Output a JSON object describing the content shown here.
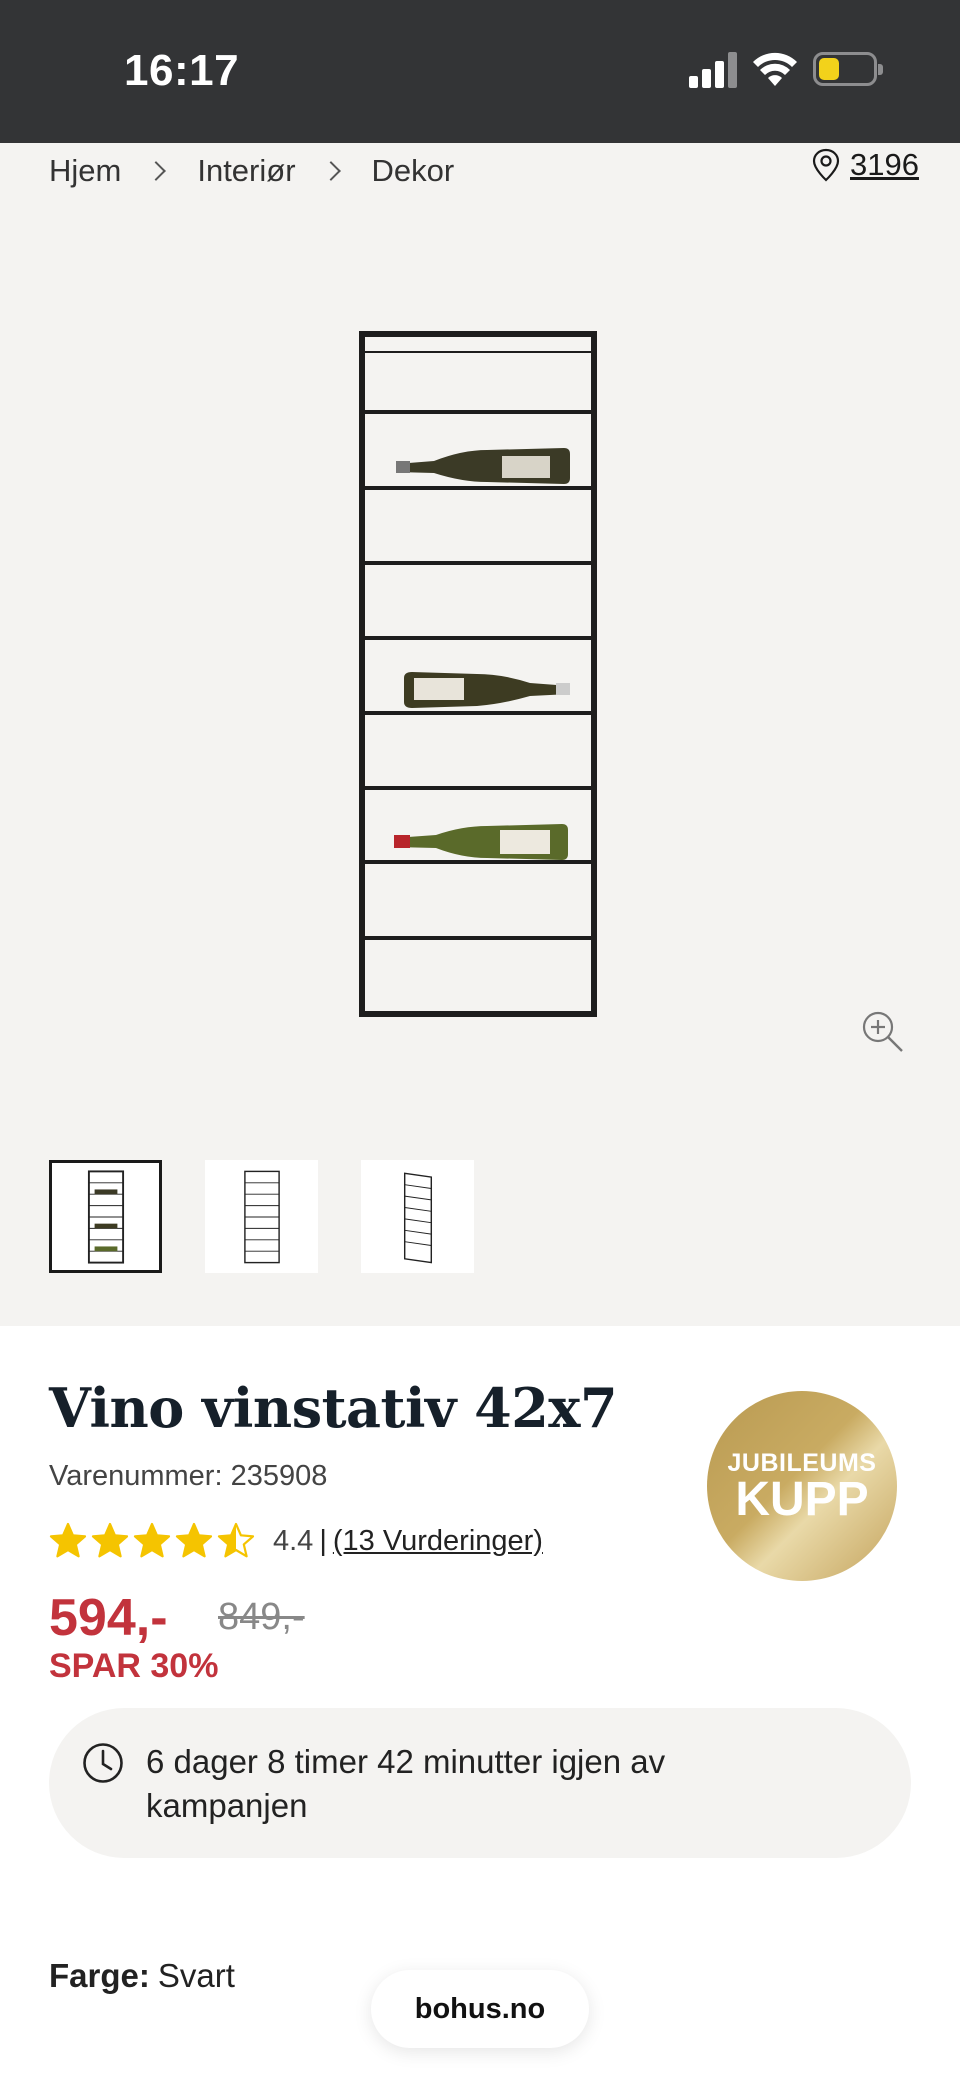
{
  "status_bar": {
    "time": "16:17",
    "battery_color": "#f2d21b"
  },
  "breadcrumb": {
    "items": [
      "Hjem",
      "Interiør",
      "Dekor"
    ]
  },
  "store": {
    "icon": "location-pin-icon",
    "number": "3196"
  },
  "gallery": {
    "background": "#f4f3f1",
    "zoom_icon": "zoom-in-icon",
    "thumbnails": [
      {
        "name": "thumbnail-front-with-bottles",
        "active": true
      },
      {
        "name": "thumbnail-front-empty",
        "active": false
      },
      {
        "name": "thumbnail-side-angle",
        "active": false
      }
    ]
  },
  "product": {
    "title": "Vino vinstativ 42x7",
    "sku_label": "Varenummer: 235908",
    "rating": {
      "value": 4.4,
      "score_text": "4.4",
      "separator": "|",
      "count_text": "(13 Vurderinger)"
    },
    "price": "594,-",
    "old_price": "849,-",
    "save_text": "SPAR 30%",
    "price_color": "#c2333c",
    "badge": {
      "line1": "JUBILEUMS",
      "line2": "KUPP"
    },
    "campaign": {
      "icon": "clock-icon",
      "text": "6 dager 8 timer 42 minutter igjen av kampanjen"
    },
    "color": {
      "label": "Farge:",
      "value": "Svart"
    }
  },
  "browser": {
    "domain": "bohus.no"
  }
}
